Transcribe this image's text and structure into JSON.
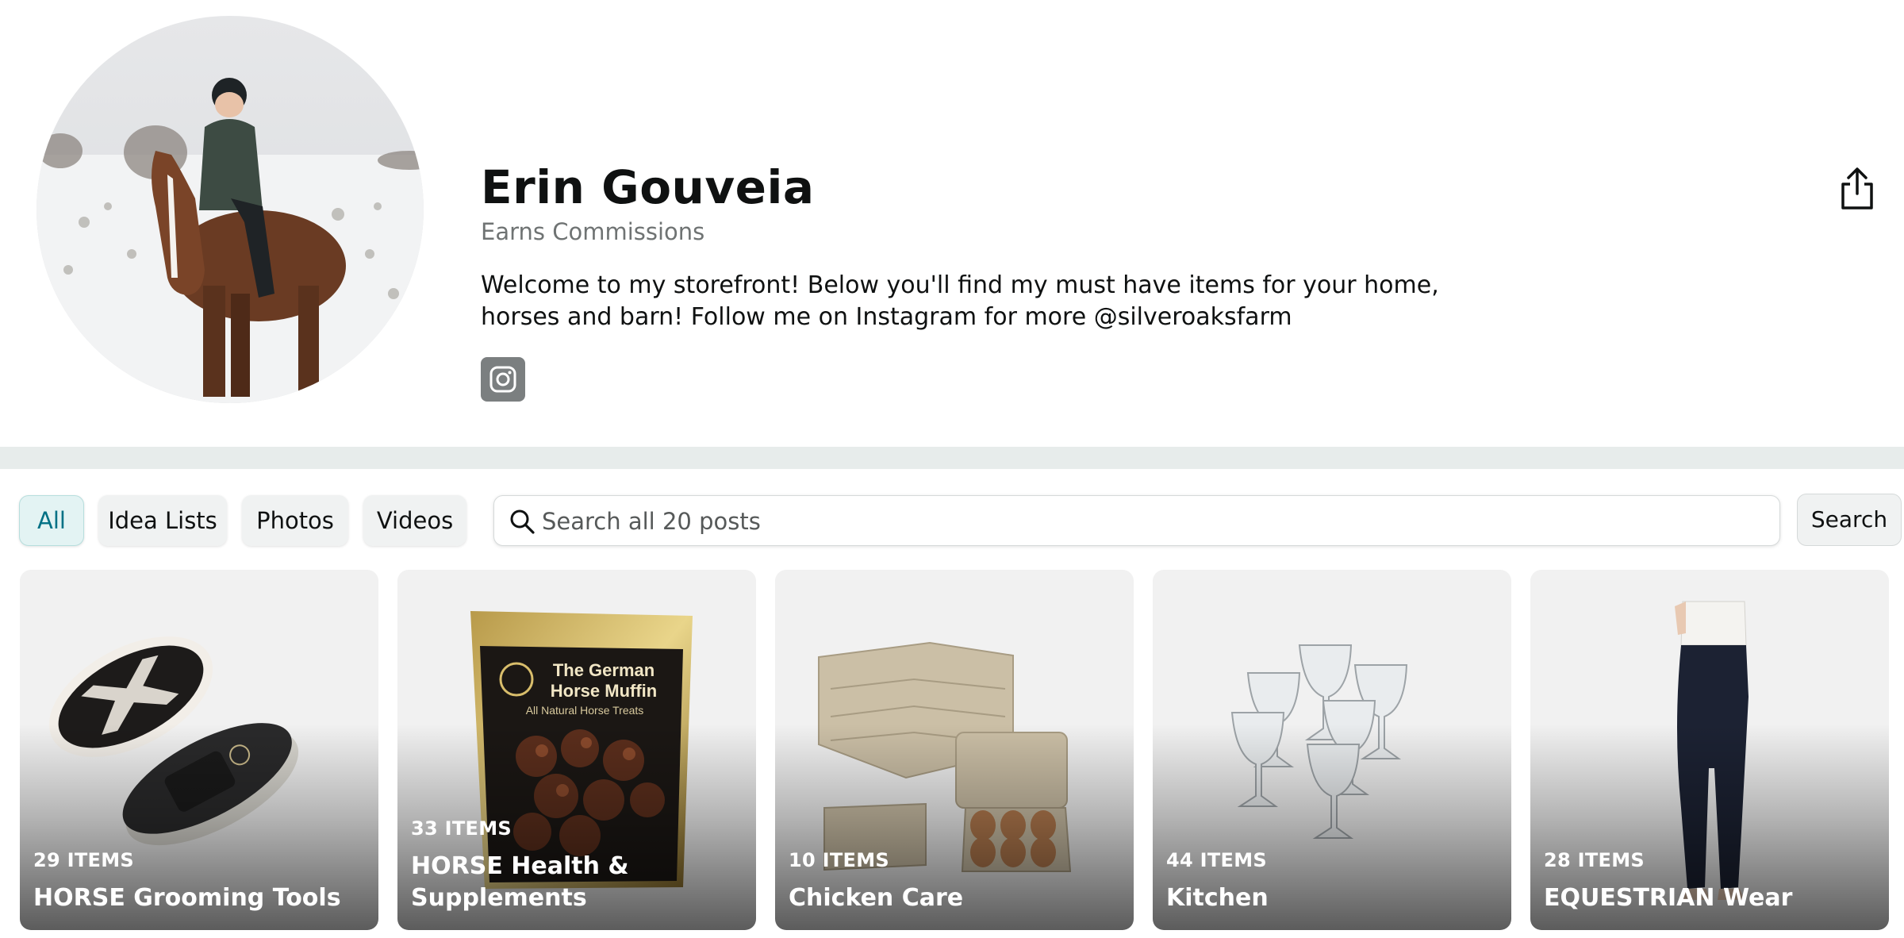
{
  "profile": {
    "name": "Erin Gouveia",
    "subtitle": "Earns Commissions",
    "bio": "Welcome to my storefront! Below you'll find my must have items for your home, horses and barn! Follow me on Instagram for more @silveroaksfarm",
    "avatar": "rider-on-horse-in-snow-photo",
    "social_icon": "instagram-icon",
    "share_icon": "share-icon"
  },
  "filters": {
    "tabs": [
      {
        "label": "All",
        "active": true
      },
      {
        "label": "Idea Lists",
        "active": false
      },
      {
        "label": "Photos",
        "active": false
      },
      {
        "label": "Videos",
        "active": false
      }
    ],
    "search_placeholder": "Search all 20 posts",
    "search_button": "Search",
    "search_icon": "magnifier-icon"
  },
  "lists": [
    {
      "count": "29 ITEMS",
      "title": "HORSE Grooming Tools",
      "image": "horse-grooming-brushes"
    },
    {
      "count": "33 ITEMS",
      "title": "HORSE Health & Supplements",
      "image": "horse-treat-bag"
    },
    {
      "count": "10 ITEMS",
      "title": "Chicken Care",
      "image": "egg-cartons"
    },
    {
      "count": "44 ITEMS",
      "title": "Kitchen",
      "image": "stemmed-glasses"
    },
    {
      "count": "28 ITEMS",
      "title": "EQUESTRIAN Wear",
      "image": "riding-tights"
    }
  ],
  "product_labels": {
    "treat_bag_line1": "The German",
    "treat_bag_line2": "Horse Muffin",
    "treat_bag_line3": "All Natural Horse Treats"
  },
  "colors": {
    "active_tab_text": "#007185",
    "active_tab_bg": "#e3f3f3",
    "muted_text": "#6f7373",
    "divider": "#e7eceb"
  }
}
